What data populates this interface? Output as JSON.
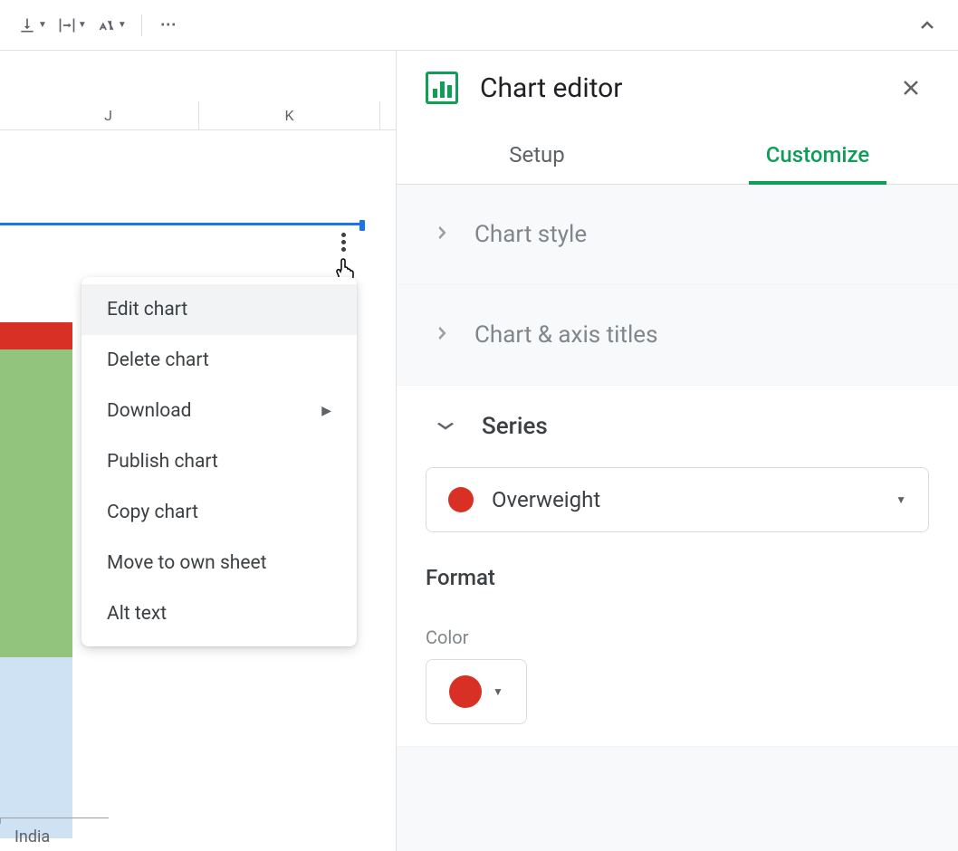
{
  "columns": [
    "J",
    "K"
  ],
  "contextMenu": {
    "items": [
      {
        "label": "Edit chart",
        "active": true,
        "submenu": false
      },
      {
        "label": "Delete chart",
        "active": false,
        "submenu": false
      },
      {
        "label": "Download",
        "active": false,
        "submenu": true
      },
      {
        "label": "Publish chart",
        "active": false,
        "submenu": false
      },
      {
        "label": "Copy chart",
        "active": false,
        "submenu": false
      },
      {
        "label": "Move to own sheet",
        "active": false,
        "submenu": false
      },
      {
        "label": "Alt text",
        "active": false,
        "submenu": false
      }
    ]
  },
  "chartAxis": {
    "label": "India"
  },
  "sidebar": {
    "title": "Chart editor",
    "tabs": {
      "setup": "Setup",
      "customize": "Customize"
    },
    "sections": {
      "chartStyle": "Chart style",
      "chartAxisTitles": "Chart & axis titles",
      "series": "Series"
    },
    "series": {
      "selected": "Overweight",
      "color": "#d93025"
    },
    "format": {
      "heading": "Format",
      "colorLabel": "Color"
    }
  }
}
